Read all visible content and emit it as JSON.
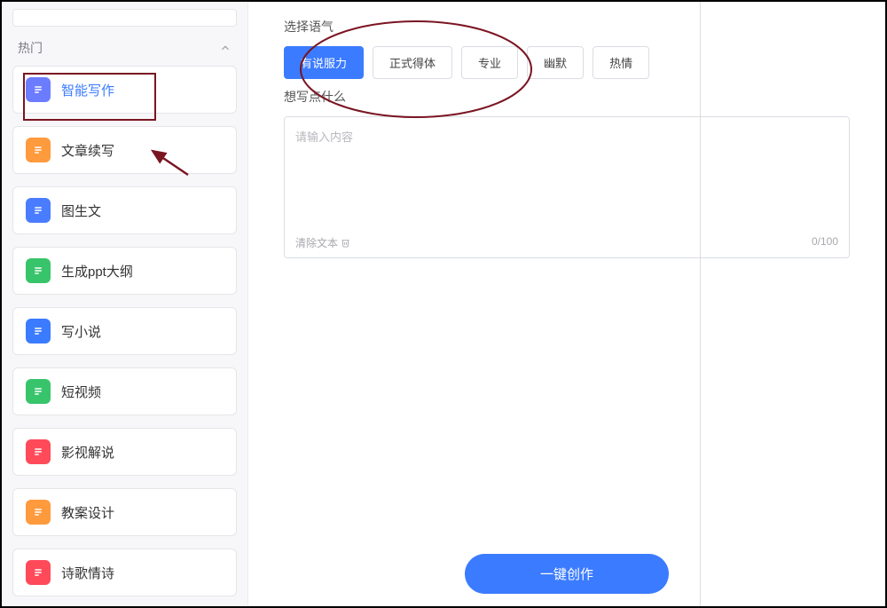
{
  "sidebar": {
    "category_label": "热门",
    "items": [
      {
        "label": "智能写作",
        "icon": "doc-write-icon",
        "color": "#6c7cff",
        "active": true
      },
      {
        "label": "文章续写",
        "icon": "doc-lines-icon",
        "color": "#ff9a3d",
        "active": false
      },
      {
        "label": "图生文",
        "icon": "image-text-icon",
        "color": "#4a7cff",
        "active": false
      },
      {
        "label": "生成ppt大纲",
        "icon": "doc-outline-icon",
        "color": "#38c46b",
        "active": false
      },
      {
        "label": "写小说",
        "icon": "doc-lines2-icon",
        "color": "#3b7bff",
        "active": false
      },
      {
        "label": "短视频",
        "icon": "doc-video-icon",
        "color": "#38c46b",
        "active": false
      },
      {
        "label": "影视解说",
        "icon": "doc-film-icon",
        "color": "#ff4a5a",
        "active": false
      },
      {
        "label": "教案设计",
        "icon": "doc-teach-icon",
        "color": "#ff9a3d",
        "active": false
      },
      {
        "label": "诗歌情诗",
        "icon": "poem-icon",
        "color": "#ff4a5a",
        "active": false
      }
    ]
  },
  "main": {
    "tone_label": "选择语气",
    "tones": [
      {
        "label": "有说服力",
        "active": true
      },
      {
        "label": "正式得体",
        "active": false
      },
      {
        "label": "专业",
        "active": false
      },
      {
        "label": "幽默",
        "active": false
      },
      {
        "label": "热情",
        "active": false
      }
    ],
    "content_label": "想写点什么",
    "placeholder": "请输入内容",
    "clear_label": "清除文本",
    "counter": "0/100",
    "cta_label": "一键创作"
  }
}
